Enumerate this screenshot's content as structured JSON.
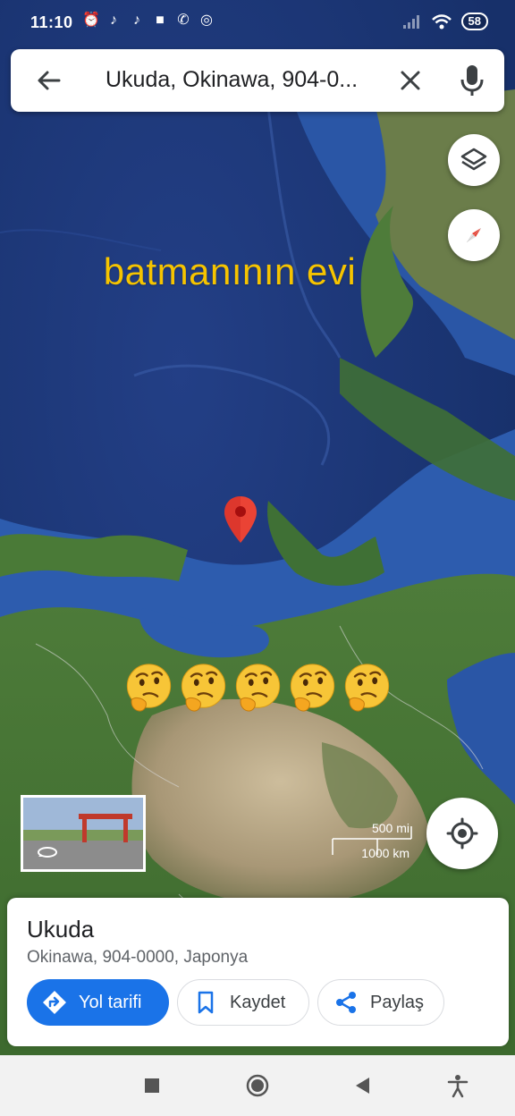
{
  "status_bar": {
    "time": "11:10",
    "battery": "58"
  },
  "search": {
    "query": "Ukuda, Okinawa, 904-0..."
  },
  "map": {
    "overlay_caption": "batmanının evi",
    "emoji": [
      "🤔",
      "🤔",
      "🤔",
      "🤔",
      "🤔"
    ],
    "scale_top": "500 mi",
    "scale_bottom": "1000 km",
    "colors": {
      "ocean_deep": "#1b3a7a",
      "ocean_shallow": "#2f5fb3",
      "land": "#4f7a3a",
      "desert": "#b9a98a",
      "caption": "#f6c400",
      "pin": "#ea4335"
    }
  },
  "place": {
    "name": "Ukuda",
    "address": "Okinawa, 904-0000, Japonya",
    "directions_label": "Yol tarifi",
    "save_label": "Kaydet",
    "share_label": "Paylaş"
  },
  "icons": {
    "back": "arrow-left-icon",
    "clear": "close-icon",
    "mic": "microphone-icon",
    "layers": "layers-icon",
    "compass": "compass-icon",
    "location": "my-location-icon",
    "directions": "directions-icon",
    "save": "bookmark-icon",
    "share": "share-icon",
    "streetview": "rotate-360-icon"
  },
  "accent_color": "#1a73e8"
}
